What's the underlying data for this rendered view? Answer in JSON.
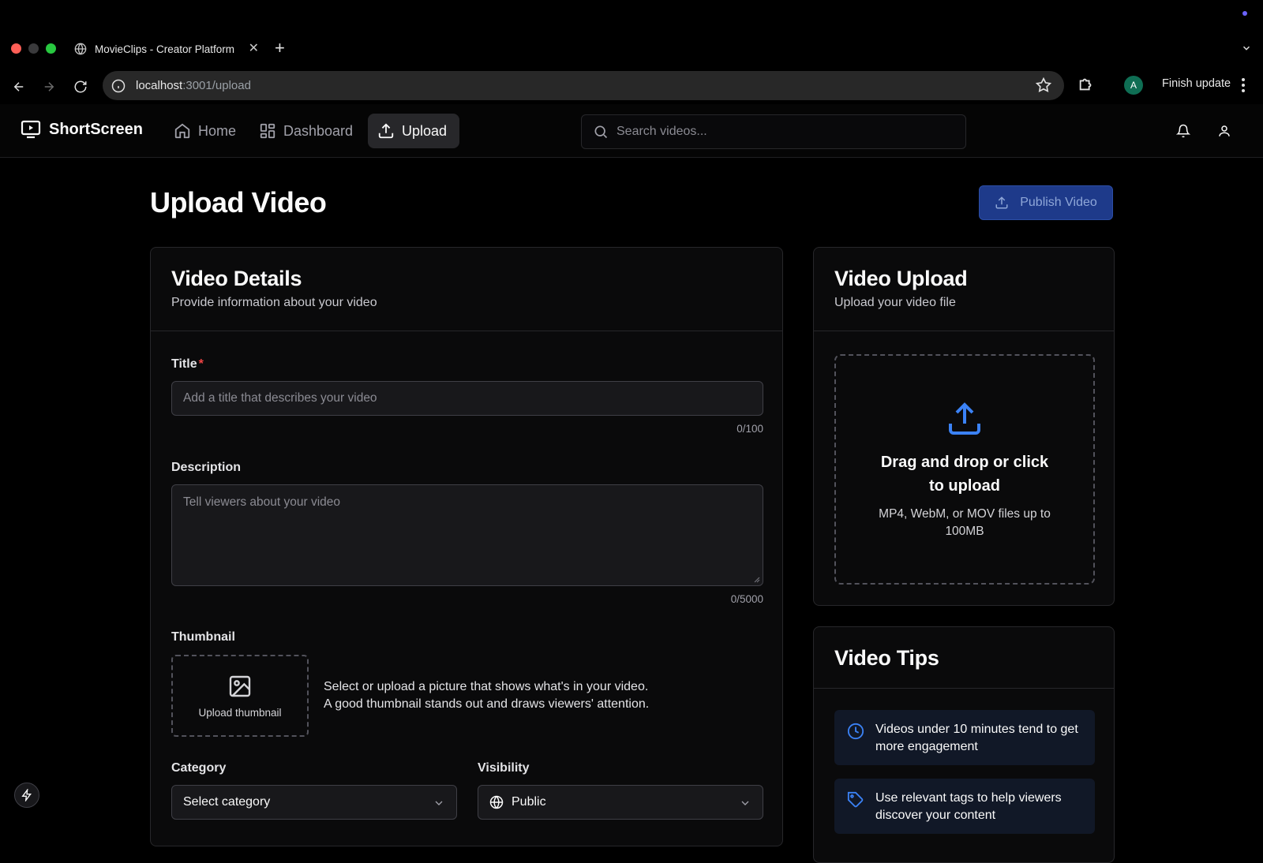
{
  "browser": {
    "tab_title": "MovieClips - Creator Platform",
    "url_host": "localhost",
    "url_path": ":3001/upload",
    "profile_initial": "A",
    "finish_update_label": "Finish update"
  },
  "app": {
    "brand": "ShortScreen",
    "nav": [
      {
        "label": "Home",
        "icon": "home-icon"
      },
      {
        "label": "Dashboard",
        "icon": "dashboard-icon"
      },
      {
        "label": "Upload",
        "icon": "upload-icon",
        "active": true
      }
    ],
    "search_placeholder": "Search videos..."
  },
  "page": {
    "title": "Upload Video",
    "publish_label": "Publish Video"
  },
  "details": {
    "title": "Video Details",
    "subtitle": "Provide information about your video",
    "title_label": "Title",
    "required_mark": "*",
    "title_placeholder": "Add a title that describes your video",
    "title_counter": "0/100",
    "description_label": "Description",
    "description_placeholder": "Tell viewers about your video",
    "description_counter": "0/5000",
    "thumbnail_label": "Thumbnail",
    "thumbnail_button": "Upload thumbnail",
    "thumbnail_help_1": "Select or upload a picture that shows what's in your video.",
    "thumbnail_help_2": "A good thumbnail stands out and draws viewers' attention.",
    "category_label": "Category",
    "category_value": "Select category",
    "visibility_label": "Visibility",
    "visibility_value": "Public"
  },
  "upload": {
    "title": "Video Upload",
    "subtitle": "Upload your video file",
    "drop_title": "Drag and drop or click to upload",
    "drop_sub": "MP4, WebM, or MOV files up to 100MB"
  },
  "tips": {
    "title": "Video Tips",
    "items": [
      {
        "text": "Videos under 10 minutes tend to get more engagement",
        "icon": "clock-icon"
      },
      {
        "text": "Use relevant tags to help viewers discover your content",
        "icon": "tag-icon"
      }
    ]
  },
  "colors": {
    "accent": "#1e3a8a",
    "upload_icon": "#3b82f6",
    "required": "#ef4444"
  }
}
